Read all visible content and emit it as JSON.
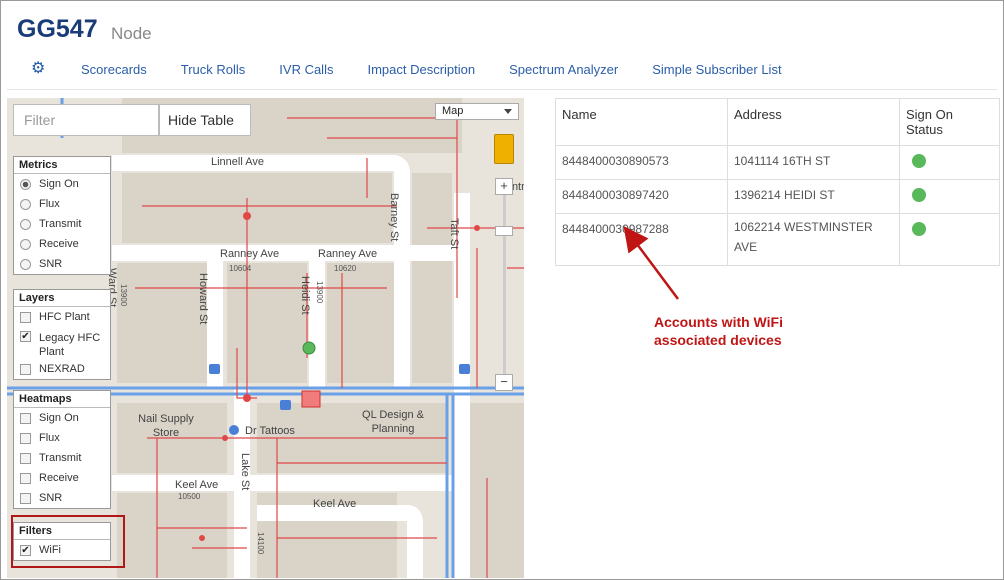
{
  "header": {
    "title": "GG547",
    "subtitle": "Node"
  },
  "nav": {
    "icon": "gear-icon",
    "items": [
      "Scorecards",
      "Truck Rolls",
      "IVR Calls",
      "Impact Description",
      "Spectrum Analyzer",
      "Simple Subscriber List"
    ]
  },
  "map": {
    "filter_placeholder": "Filter",
    "hide_table_label": "Hide Table",
    "map_type": "Map",
    "streets": {
      "linnell": "Linnell Ave",
      "ranney1": "Ranney Ave",
      "ranney2": "Ranney Ave",
      "barney": "Barney St",
      "taft": "Taft St",
      "howard": "Howard St",
      "heidi": "Heidi St",
      "ward": "Ward St",
      "lake": "Lake St",
      "keel1": "Keel Ave",
      "keel2": "Keel Ave"
    },
    "numbers": {
      "n10604": "10604",
      "n10620": "10620",
      "n13900a": "13900",
      "n13900b": "13900",
      "n10500": "10500",
      "n14100": "14100"
    },
    "places": {
      "nail": "Nail Supply Store",
      "tattoos": "Dr Tattoos",
      "ql": "QL Design & Planning",
      "edge": "Cntry"
    },
    "colors": {
      "plant": "#e04848",
      "road_main": "#6aa0e8"
    }
  },
  "panels": {
    "metrics": {
      "title": "Metrics",
      "items": [
        "Sign On",
        "Flux",
        "Transmit",
        "Receive",
        "SNR"
      ],
      "selected": "Sign On"
    },
    "layers": {
      "title": "Layers",
      "items": [
        "HFC Plant",
        "Legacy HFC Plant",
        "NEXRAD"
      ],
      "checked": [
        "Legacy HFC Plant"
      ]
    },
    "heatmaps": {
      "title": "Heatmaps",
      "items": [
        "Sign On",
        "Flux",
        "Transmit",
        "Receive",
        "SNR"
      ]
    },
    "filters": {
      "title": "Filters",
      "items": [
        "WiFi"
      ],
      "checked": [
        "WiFi"
      ]
    }
  },
  "table": {
    "columns": [
      "Name",
      "Address",
      "Sign On Status"
    ],
    "rows": [
      {
        "name": "8448400030890573",
        "address": "1041114 16TH ST",
        "status": "green"
      },
      {
        "name": "8448400030897420",
        "address": "1396214 HEIDI ST",
        "status": "green"
      },
      {
        "name": "8448400030987288",
        "address": "1062214 WESTMINSTER AVE",
        "status": "green"
      }
    ]
  },
  "annotation": {
    "line1": "Accounts with WiFi",
    "line2": "associated devices",
    "color": "#c01515"
  }
}
